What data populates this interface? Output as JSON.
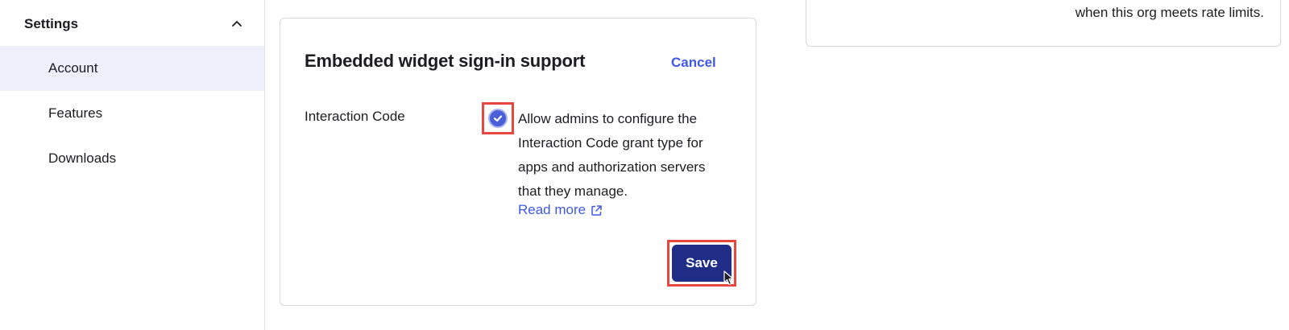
{
  "sidebar": {
    "section_title": "Settings",
    "items": [
      {
        "label": "Account",
        "active": true
      },
      {
        "label": "Features",
        "active": false
      },
      {
        "label": "Downloads",
        "active": false
      }
    ]
  },
  "card": {
    "title": "Embedded widget sign-in support",
    "cancel_label": "Cancel",
    "field_label": "Interaction Code",
    "checkbox_checked": true,
    "description_lines": [
      "Allow admins to configure the",
      "Interaction Code grant type for",
      "apps and authorization servers",
      "that they manage."
    ],
    "read_more_label": "Read more",
    "save_label": "Save"
  },
  "right_card": {
    "text": "when this org meets rate limits."
  },
  "colors": {
    "accent": "#3f59e4",
    "primary_button": "#1f2d86",
    "active_nav_bg": "#eef0fb",
    "highlight": "#e8473f"
  }
}
